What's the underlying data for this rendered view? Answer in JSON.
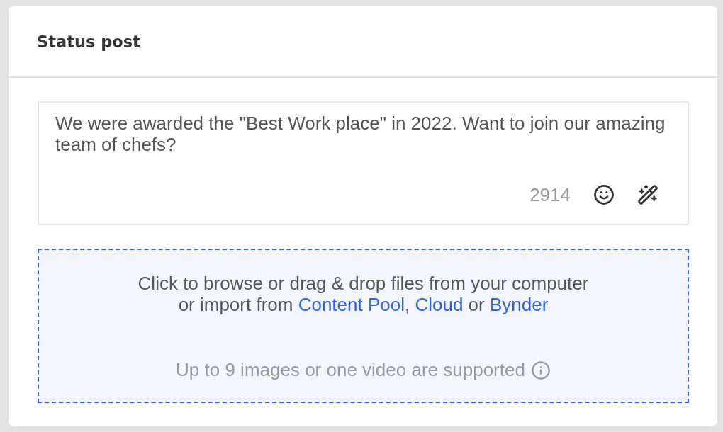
{
  "panel": {
    "title": "Status post"
  },
  "composer": {
    "value": "We were awarded the \"Best Work place\" in 2022. Want to join our amazing team of chefs?",
    "character_count": "2914"
  },
  "upload": {
    "lines": [
      {
        "parts": [
          {
            "kind": "text",
            "text": "Click to browse or drag & drop files from your computer"
          }
        ]
      },
      {
        "parts": [
          {
            "kind": "text",
            "text": "or import from "
          },
          {
            "kind": "link",
            "text": "Content Pool"
          },
          {
            "kind": "text",
            "text": ", "
          },
          {
            "kind": "link",
            "text": "Cloud"
          },
          {
            "kind": "text",
            "text": " or "
          },
          {
            "kind": "link",
            "text": "Bynder"
          }
        ]
      }
    ],
    "hint": "Up to 9 images or one video are supported"
  }
}
